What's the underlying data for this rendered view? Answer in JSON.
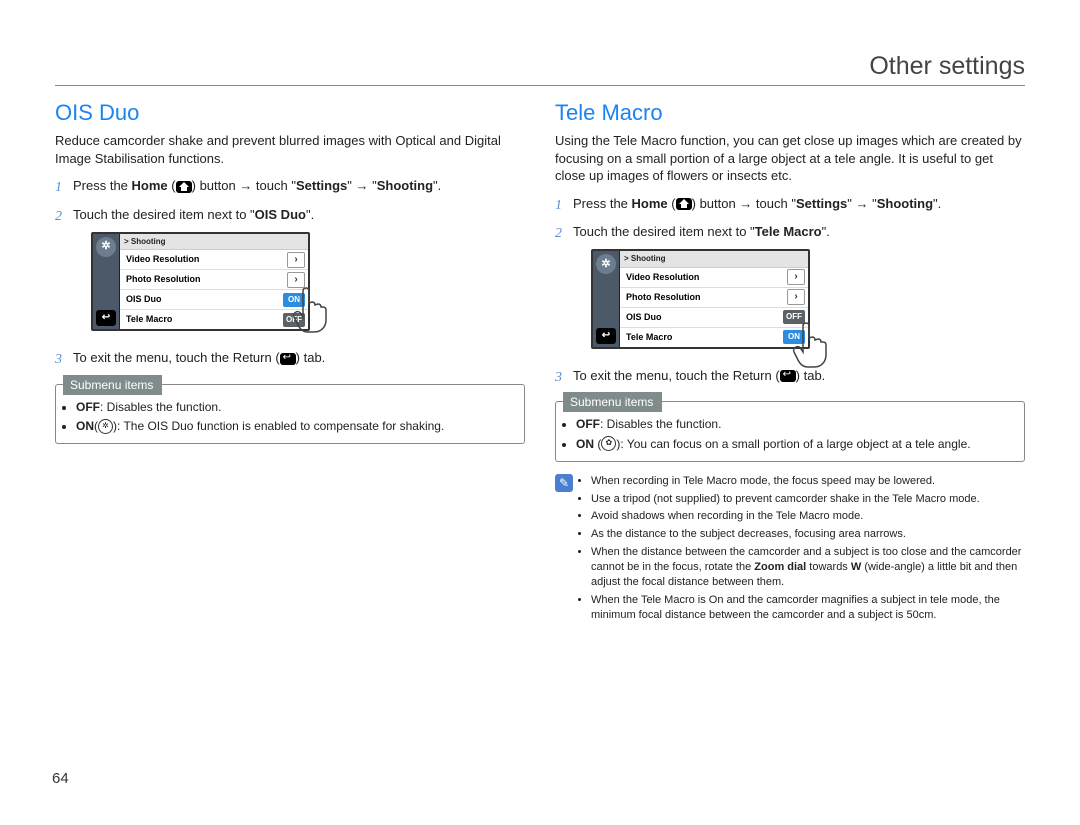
{
  "header": "Other settings",
  "page_number": "64",
  "left": {
    "title": "OIS Duo",
    "intro": "Reduce camcorder shake and prevent blurred images with Optical and Digital Image Stabilisation functions.",
    "step1_a": "Press the ",
    "step1_home": "Home",
    "step1_b": " button → touch \"",
    "step1_settings": "Settings",
    "step1_c": "\" → \"",
    "step1_shoot": "Shooting",
    "step1_d": "\".",
    "step2_a": "Touch the desired item next to \"",
    "step2_bold": "OIS Duo",
    "step2_b": "\".",
    "step3": "To exit the menu, touch the Return (",
    "step3_b": ") tab.",
    "submenu_title": "Submenu items",
    "submenu": [
      {
        "bold": "OFF",
        "rest": ": Disables the function."
      },
      {
        "bold": "ON",
        "iconed": true,
        "rest": ": The OIS Duo function is enabled to compensate for shaking."
      }
    ],
    "screen": {
      "crumb": "> Shooting",
      "rows": [
        {
          "label": "Video Resolution",
          "type": "chev"
        },
        {
          "label": "Photo Resolution",
          "type": "chev"
        },
        {
          "label": "OIS Duo",
          "type": "on",
          "value": "ON"
        },
        {
          "label": "Tele Macro",
          "type": "off",
          "value": "OFF"
        }
      ]
    }
  },
  "right": {
    "title": "Tele Macro",
    "intro": "Using the Tele Macro function, you can get close up images which are created by focusing on a small portion of a large object at a tele angle. It is useful to get close up images of flowers or insects etc.",
    "step1_a": "Press the ",
    "step1_home": "Home",
    "step1_b": " button → touch \"",
    "step1_settings": "Settings",
    "step1_c": "\" → \"",
    "step1_shoot": "Shooting",
    "step1_d": "\".",
    "step2_a": "Touch the desired item next to \"",
    "step2_bold": "Tele Macro",
    "step2_b": "\".",
    "step3": "To exit the menu, touch the Return (",
    "step3_b": ") tab.",
    "submenu_title": "Submenu items",
    "submenu": [
      {
        "bold": "OFF",
        "rest": ": Disables the function."
      },
      {
        "bold": "ON",
        "iconed": true,
        "rest": ": You can focus on a small portion of a large object at a tele angle."
      }
    ],
    "notes": [
      "When recording in Tele Macro mode, the focus speed may be lowered.",
      "Use a tripod (not supplied) to prevent camcorder shake in the Tele Macro mode.",
      "Avoid shadows when recording in the Tele Macro mode.",
      "As the distance to the subject decreases, focusing area narrows.",
      {
        "pre": "When the distance between the camcorder and a subject is too close and the camcorder cannot be in the focus, rotate the ",
        "bold": "Zoom dial",
        "mid": " towards ",
        "bold2": "W",
        "post": " (wide-angle) a little bit and then adjust the focal distance between them."
      },
      "When the Tele Macro is On and the camcorder magnifies a subject in tele mode, the minimum focal distance between the camcorder and a subject is 50cm."
    ],
    "screen": {
      "crumb": "> Shooting",
      "rows": [
        {
          "label": "Video Resolution",
          "type": "chev"
        },
        {
          "label": "Photo Resolution",
          "type": "chev"
        },
        {
          "label": "OIS Duo",
          "type": "off",
          "value": "OFF"
        },
        {
          "label": "Tele Macro",
          "type": "on",
          "value": "ON"
        }
      ]
    }
  }
}
